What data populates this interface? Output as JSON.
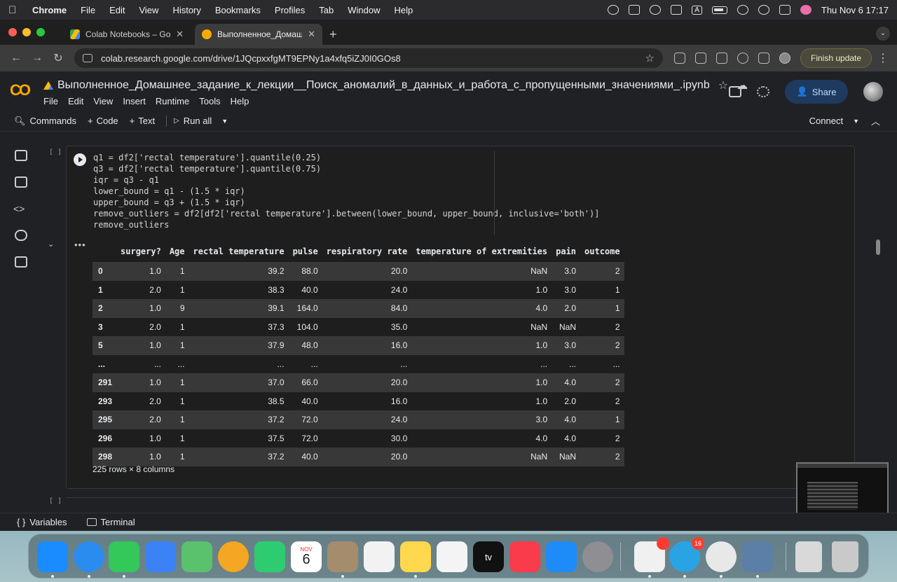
{
  "menubar": {
    "app": "Chrome",
    "items": [
      "File",
      "Edit",
      "View",
      "History",
      "Bookmarks",
      "Profiles",
      "Tab",
      "Window",
      "Help"
    ],
    "datetime": "Thu Nov 6  17:17",
    "badge": "A"
  },
  "tabs": [
    {
      "label": "Colab Notebooks – Google Д",
      "active": false
    },
    {
      "label": "Выполненное_Домашнее_з",
      "active": true
    }
  ],
  "toolbar": {
    "url": "colab.research.google.com/drive/1JQcpxxfgMT9EPNy1a4xfq5iZJ0I0GOs8",
    "finish_update": "Finish update"
  },
  "colab": {
    "logo": "CO",
    "title": "Выполненное_Домашнее_задание_к_лекции__Поиск_аномалий_в_данных_и_работа_с_пропущенными_значениями_.ipynb",
    "menu": [
      "File",
      "Edit",
      "View",
      "Insert",
      "Runtime",
      "Tools",
      "Help"
    ],
    "share": "Share",
    "commands": "Commands",
    "add_code": "Code",
    "add_text": "Text",
    "run_all": "Run all",
    "connect": "Connect"
  },
  "cell": {
    "bracket": "[ ]",
    "code_lines": [
      "q1 = df2['rectal temperature'].quantile(0.25)",
      "q3 = df2['rectal temperature'].quantile(0.75)",
      "iqr = q3 - q1",
      "lower_bound = q1 - (1.5 * iqr)",
      "upper_bound = q3 + (1.5 * iqr)",
      "remove_outliers = df2[df2['rectal temperature'].between(lower_bound, upper_bound, inclusive='both')]",
      "remove_outliers"
    ]
  },
  "dataframe": {
    "columns": [
      "",
      "surgery?",
      "Age",
      "rectal temperature",
      "pulse",
      "respiratory rate",
      "temperature of extremities",
      "pain",
      "outcome"
    ],
    "rows": [
      [
        "0",
        "1.0",
        "1",
        "39.2",
        "88.0",
        "20.0",
        "NaN",
        "3.0",
        "2"
      ],
      [
        "1",
        "2.0",
        "1",
        "38.3",
        "40.0",
        "24.0",
        "1.0",
        "3.0",
        "1"
      ],
      [
        "2",
        "1.0",
        "9",
        "39.1",
        "164.0",
        "84.0",
        "4.0",
        "2.0",
        "1"
      ],
      [
        "3",
        "2.0",
        "1",
        "37.3",
        "104.0",
        "35.0",
        "NaN",
        "NaN",
        "2"
      ],
      [
        "5",
        "1.0",
        "1",
        "37.9",
        "48.0",
        "16.0",
        "1.0",
        "3.0",
        "2"
      ],
      [
        "...",
        "...",
        "...",
        "...",
        "...",
        "...",
        "...",
        "...",
        "..."
      ],
      [
        "291",
        "1.0",
        "1",
        "37.0",
        "66.0",
        "20.0",
        "1.0",
        "4.0",
        "2"
      ],
      [
        "293",
        "2.0",
        "1",
        "38.5",
        "40.0",
        "16.0",
        "1.0",
        "2.0",
        "2"
      ],
      [
        "295",
        "2.0",
        "1",
        "37.2",
        "72.0",
        "24.0",
        "3.0",
        "4.0",
        "1"
      ],
      [
        "296",
        "1.0",
        "1",
        "37.5",
        "72.0",
        "30.0",
        "4.0",
        "4.0",
        "2"
      ],
      [
        "298",
        "1.0",
        "1",
        "37.2",
        "40.0",
        "20.0",
        "NaN",
        "NaN",
        "2"
      ]
    ],
    "shape": "225 rows × 8 columns"
  },
  "bottombar": {
    "variables": "Variables",
    "terminal": "Terminal"
  },
  "dock": {
    "calendar_month": "NOV",
    "calendar_day": "6",
    "tv_label": "tv",
    "telegram_badge": "16",
    "colors": {
      "finder": "#1a8cff",
      "safari": "#2b8cf0",
      "messages": "#34c759",
      "mail": "#3b82f6",
      "maps": "#5ac26c",
      "photos": "#f5a623",
      "facetime": "#2ecc71",
      "contacts": "#a58c6d",
      "reminders": "#f2f2f2",
      "notes": "#ffd84d",
      "freeform": "#f4f4f4",
      "music": "#fa3b4c",
      "appstore": "#1d8cf8",
      "settings": "#8e8e93",
      "app1": "#f0f0f0",
      "telegram": "#2aa3e4",
      "chrome": "#e8e8e8",
      "app2": "#5b7fa6",
      "files": "#d9d9d9",
      "trash": "#c9c9c9"
    }
  }
}
